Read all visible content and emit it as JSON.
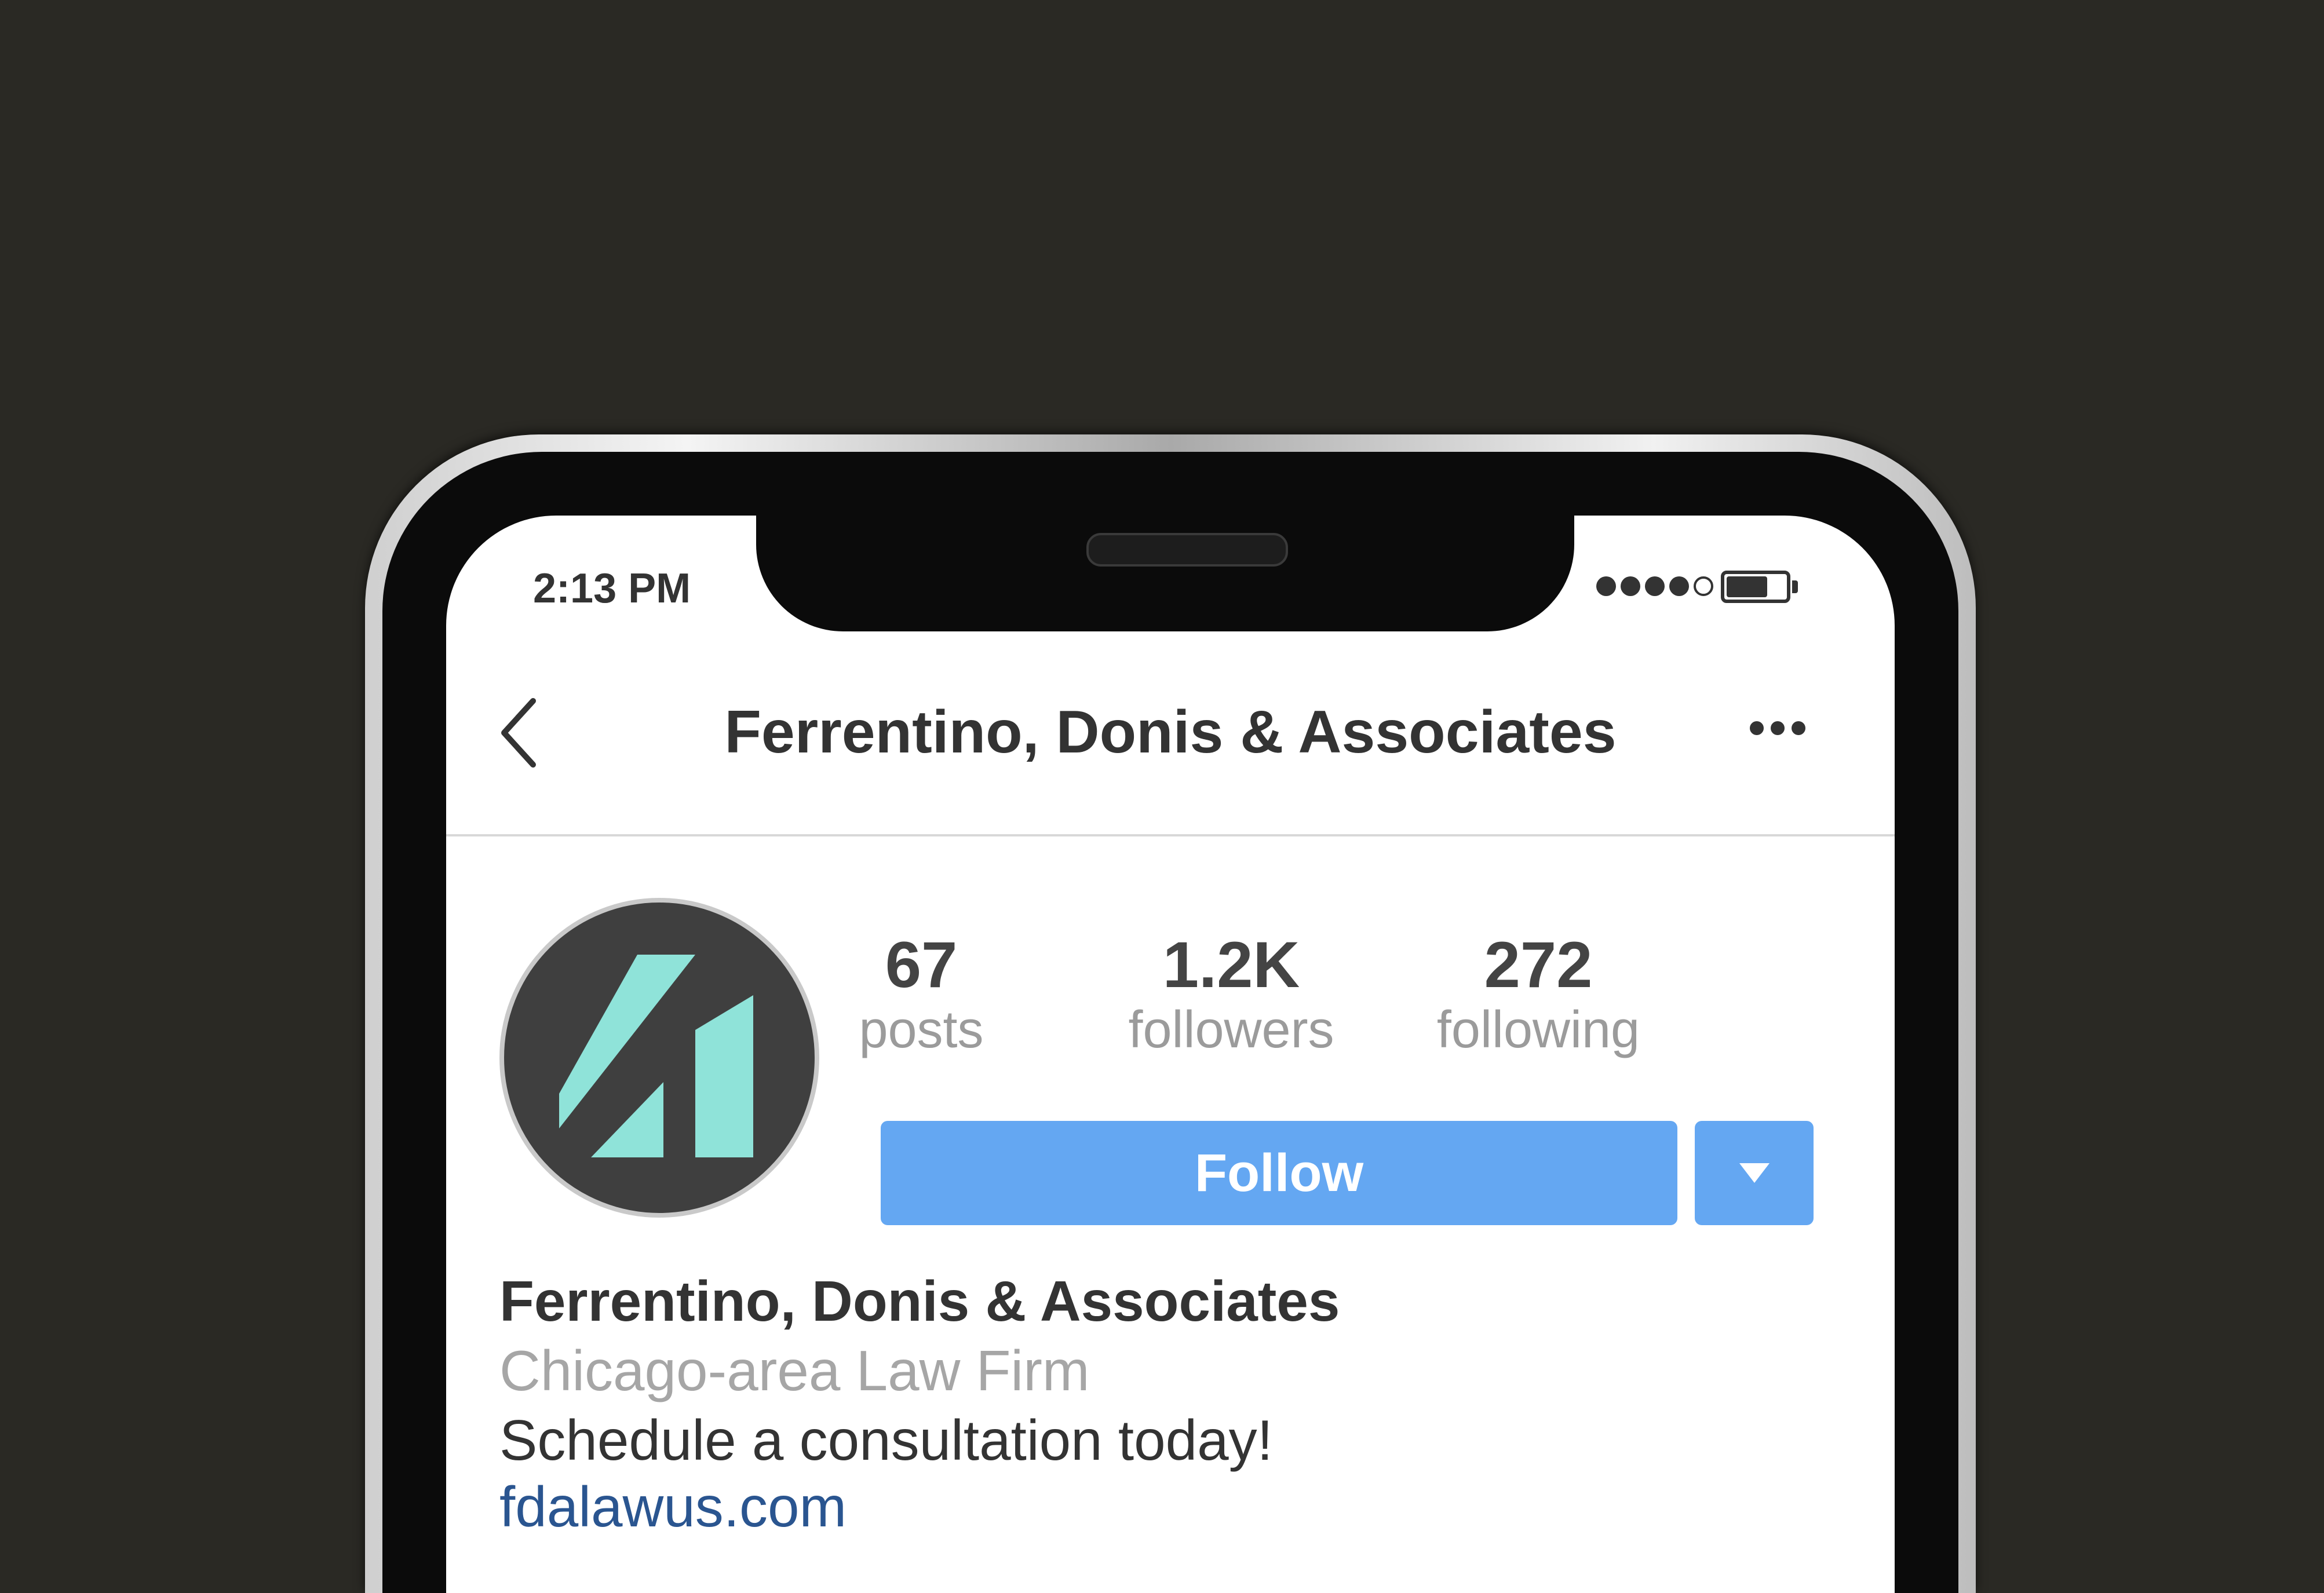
{
  "status_bar": {
    "time": "2:13 PM",
    "signal_bars": 4,
    "signal_max": 5,
    "battery_level": 0.6
  },
  "header": {
    "title": "Ferrentino, Donis & Associates",
    "back_icon": "chevron-left-icon",
    "more_icon": "ellipsis-icon"
  },
  "profile": {
    "avatar_icon": "logo",
    "stats": [
      {
        "value": "67",
        "label": "posts"
      },
      {
        "value": "1.2K",
        "label": "followers"
      },
      {
        "value": "272",
        "label": "following"
      }
    ],
    "follow_label": "Follow",
    "dropdown_icon": "caret-down-icon",
    "button_color": "#64a7f2"
  },
  "bio": {
    "name": "Ferrentino, Donis & Associates",
    "category": "Chicago-area Law Firm",
    "text": "Schedule a consultation today!",
    "link": "fdalawus.com"
  },
  "colors": {
    "background": "#2a2924",
    "logo_accent": "#8fe3d9",
    "avatar_bg": "#3f3f3f",
    "link": "#2a5590"
  }
}
